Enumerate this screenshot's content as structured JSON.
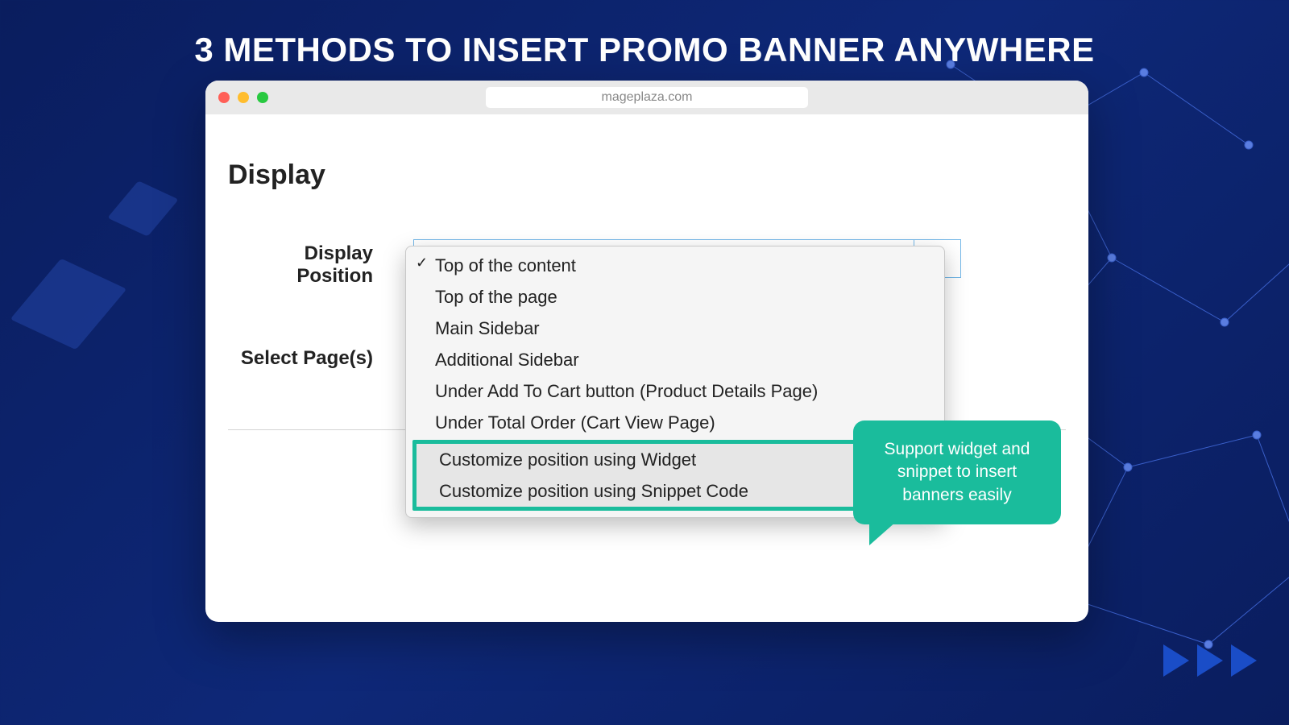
{
  "page": {
    "title": "3 METHODS TO INSERT PROMO BANNER ANYWHERE"
  },
  "browser": {
    "url": "mageplaza.com"
  },
  "form": {
    "section_title": "Display",
    "display_position_label": "Display Position",
    "select_pages_label": "Select Page(s)"
  },
  "dropdown": {
    "items": [
      "Top of the content",
      "Top of the page",
      "Main Sidebar",
      "Additional Sidebar",
      "Under Add To Cart button (Product Details Page)",
      "Under Total Order (Cart View Page)"
    ],
    "highlighted": [
      "Customize position using Widget",
      "Customize position using Snippet Code"
    ]
  },
  "callout": {
    "text": "Support widget and snippet to insert banners easily"
  }
}
